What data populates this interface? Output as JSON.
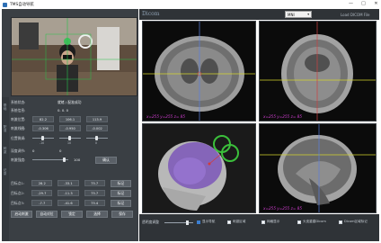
{
  "window": {
    "title": "TMS自动导航",
    "controls": [
      "—",
      "□",
      "✕"
    ]
  },
  "left": {
    "side_tabs": [
      "基础",
      "配准",
      "刺激",
      "记录"
    ],
    "fields": {
      "status_label": "系统状态:",
      "status_value": "就绪 / 配准成功",
      "hint_label": "系统信息:",
      "hint_value": "0.  0.  0",
      "pos_label": "刺激位置:",
      "pos_values": [
        "82.2",
        "106.1",
        "113.9"
      ],
      "rot_label": "刺激线圈:",
      "rot_values": [
        "-0.306",
        "-0.950",
        "-0.002"
      ],
      "adjust_label": "位置微调:",
      "adjust_ticks": [
        "-10",
        "10",
        "0"
      ],
      "depth_label": "深度调节:",
      "depth_values": [
        "0",
        "0"
      ],
      "intensity_label": "刺激强度:",
      "intensity_value": "100",
      "intensity_btn": "确认",
      "target_rows": [
        {
          "label": "目标点1:",
          "values": [
            "28.2",
            "-33.1",
            "75.7"
          ],
          "action": "标记"
        },
        {
          "label": "目标点2:",
          "values": [
            "-29.7",
            "-11.3",
            "75.7"
          ],
          "action": "标记"
        },
        {
          "label": "目标点3:",
          "values": [
            "-7.7",
            "-41.6",
            "75.4"
          ],
          "action": "标记"
        }
      ],
      "bottom_buttons": [
        "启动刺激",
        "自动对位",
        "锁定",
        "选择",
        "保存"
      ]
    }
  },
  "right": {
    "title": "Dicom",
    "slice_select": "MNI",
    "load_label": "Load DICOM File",
    "views": [
      {
        "name": "axial",
        "coords": "x=255   y=255   z= 85"
      },
      {
        "name": "axial-2",
        "coords": "x=255   y=255   z= 85"
      },
      {
        "name": "model",
        "coords": ""
      },
      {
        "name": "sagittal",
        "coords": "x=255   y=255   z= 85"
      }
    ],
    "status": {
      "slider_label": "透明度调整",
      "checks": [
        {
          "label": "显示导航",
          "on": true
        },
        {
          "label": "刺激区域",
          "on": false
        },
        {
          "label": "网格显示",
          "on": false
        },
        {
          "label": "头皮重建Dicom",
          "on": false
        },
        {
          "label": "Dicom区域标记",
          "on": false
        }
      ]
    }
  }
}
